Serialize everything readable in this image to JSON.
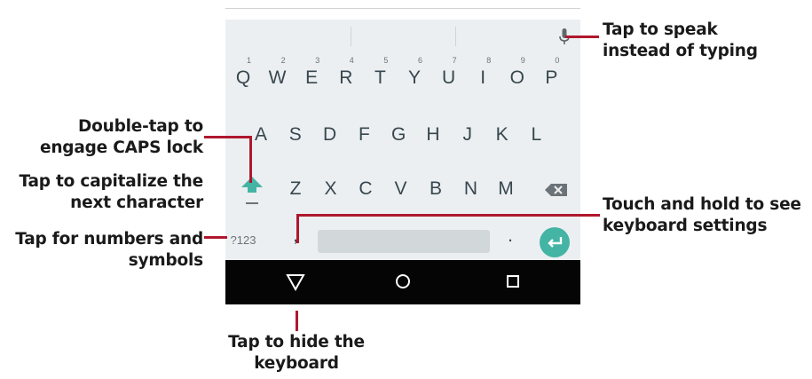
{
  "keyboard": {
    "row1": [
      {
        "k": "Q",
        "n": "1"
      },
      {
        "k": "W",
        "n": "2"
      },
      {
        "k": "E",
        "n": "3"
      },
      {
        "k": "R",
        "n": "4"
      },
      {
        "k": "T",
        "n": "5"
      },
      {
        "k": "Y",
        "n": "6"
      },
      {
        "k": "U",
        "n": "7"
      },
      {
        "k": "I",
        "n": "8"
      },
      {
        "k": "O",
        "n": "9"
      },
      {
        "k": "P",
        "n": "0"
      }
    ],
    "row2": [
      "A",
      "S",
      "D",
      "F",
      "G",
      "H",
      "J",
      "K",
      "L"
    ],
    "row3": [
      "Z",
      "X",
      "C",
      "V",
      "B",
      "N",
      "M"
    ],
    "symbols_key": "?123",
    "comma_key": ",",
    "period_key": ".",
    "icons": {
      "mic": "microphone-icon",
      "shift": "shift-arrow-icon",
      "backspace": "backspace-icon",
      "enter": "enter-icon",
      "back": "back-triangle-icon",
      "home": "home-circle-icon",
      "recents": "recents-square-icon"
    },
    "colors": {
      "accent": "#44b4a4",
      "background": "#eceff1",
      "navbar": "#050505"
    }
  },
  "annotations": {
    "speak": [
      "Tap to speak",
      "instead of typing"
    ],
    "caps": [
      "Double-tap to",
      "engage CAPS lock"
    ],
    "capitalize": [
      "Tap to capitalize the",
      "next character"
    ],
    "numbers": [
      "Tap for numbers and",
      "symbols"
    ],
    "settings": [
      "Touch and hold to see",
      "keyboard settings"
    ],
    "hide": [
      "Tap to hide the",
      "keyboard"
    ]
  }
}
